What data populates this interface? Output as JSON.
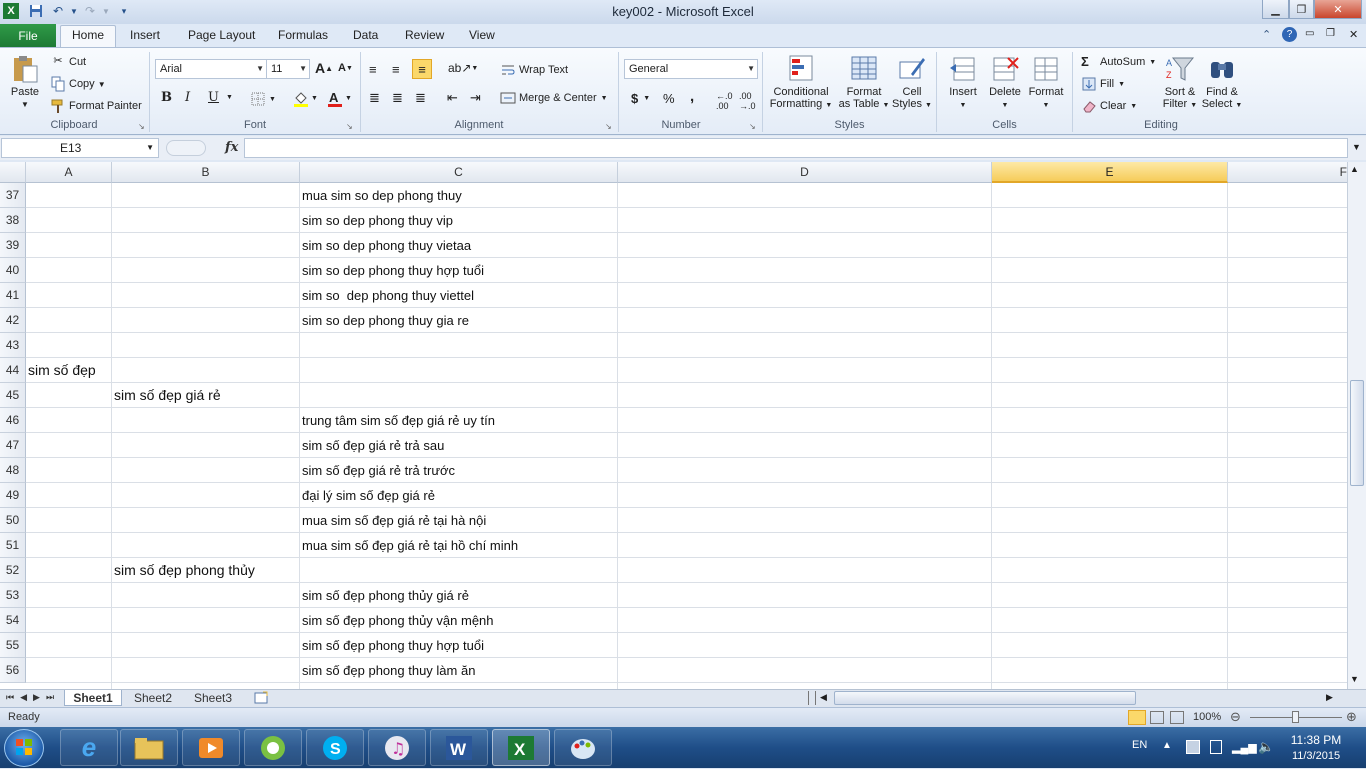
{
  "window": {
    "title": "key002  -  Microsoft Excel"
  },
  "ribbon_tabs": [
    "File",
    "Home",
    "Insert",
    "Page Layout",
    "Formulas",
    "Data",
    "Review",
    "View"
  ],
  "clipboard": {
    "paste": "Paste",
    "cut": "Cut",
    "copy": "Copy",
    "format_painter": "Format Painter",
    "label": "Clipboard"
  },
  "font": {
    "name": "Arial",
    "size": "11",
    "label": "Font",
    "bold": "B",
    "italic": "I",
    "underline": "U"
  },
  "alignment": {
    "wrap": "Wrap Text",
    "merge": "Merge & Center",
    "label": "Alignment"
  },
  "number": {
    "format": "General",
    "label": "Number",
    "currency": "$",
    "percent": "%",
    "comma": ","
  },
  "styles": {
    "conditional_l1": "Conditional",
    "conditional_l2": "Formatting",
    "table_l1": "Format",
    "table_l2": "as Table",
    "cell_l1": "Cell",
    "cell_l2": "Styles",
    "label": "Styles"
  },
  "cells": {
    "insert": "Insert",
    "delete": "Delete",
    "format": "Format",
    "label": "Cells"
  },
  "editing": {
    "autosum": "AutoSum",
    "fill": "Fill",
    "clear": "Clear",
    "sort_l1": "Sort &",
    "sort_l2": "Filter",
    "find_l1": "Find &",
    "find_l2": "Select",
    "label": "Editing"
  },
  "formula_bar": {
    "name_box": "E13",
    "fx": "fx",
    "value": ""
  },
  "columns": [
    "A",
    "B",
    "C",
    "D",
    "E",
    "F"
  ],
  "selected_column": "E",
  "rows": [
    {
      "n": "37",
      "a": "",
      "b": "",
      "c": "mua sim so dep phong thuy"
    },
    {
      "n": "38",
      "a": "",
      "b": "",
      "c": "sim so dep phong thuy vip"
    },
    {
      "n": "39",
      "a": "",
      "b": "",
      "c": "sim so dep phong thuy vietaa"
    },
    {
      "n": "40",
      "a": "",
      "b": "",
      "c": "sim so dep phong thuy hợp tuổi"
    },
    {
      "n": "41",
      "a": "",
      "b": "",
      "c": "sim so  dep phong thuy viettel"
    },
    {
      "n": "42",
      "a": "",
      "b": "",
      "c": "sim so dep phong thuy gia re"
    },
    {
      "n": "43",
      "a": "",
      "b": "",
      "c": ""
    },
    {
      "n": "44",
      "a": "sim số đẹp",
      "b": "",
      "c": ""
    },
    {
      "n": "45",
      "a": "",
      "b": "sim số đẹp giá rẻ",
      "c": ""
    },
    {
      "n": "46",
      "a": "",
      "b": "",
      "c": "trung tâm sim số đẹp giá rẻ uy tín"
    },
    {
      "n": "47",
      "a": "",
      "b": "",
      "c": "sim số đẹp giá rẻ trả sau"
    },
    {
      "n": "48",
      "a": "",
      "b": "",
      "c": "sim số đẹp giá rẻ trả trước"
    },
    {
      "n": "49",
      "a": "",
      "b": "",
      "c": "đại lý sim số đẹp giá rẻ"
    },
    {
      "n": "50",
      "a": "",
      "b": "",
      "c": "mua sim số đẹp giá rẻ tại hà nội"
    },
    {
      "n": "51",
      "a": "",
      "b": "",
      "c": "mua sim số đẹp giá rẻ tại hồ chí minh"
    },
    {
      "n": "52",
      "a": "",
      "b": "sim số đẹp phong thủy",
      "c": ""
    },
    {
      "n": "53",
      "a": "",
      "b": "",
      "c": "sim số đẹp phong thủy giá rẻ"
    },
    {
      "n": "54",
      "a": "",
      "b": "",
      "c": "sim số đẹp phong thủy vận mệnh"
    },
    {
      "n": "55",
      "a": "",
      "b": "",
      "c": "sim số đẹp phong thuy hợp tuổi"
    },
    {
      "n": "56",
      "a": "",
      "b": "",
      "c": "sim số đẹp phong thuy làm ăn"
    }
  ],
  "sheets": [
    "Sheet1",
    "Sheet2",
    "Sheet3"
  ],
  "active_sheet": "Sheet1",
  "status": {
    "ready": "Ready",
    "zoom": "100%"
  },
  "taskbar": {
    "lang": "EN",
    "time": "11:38 PM",
    "date": "11/3/2015"
  },
  "colors": {
    "file_tab": "#1d7a34",
    "selected_header": "#f6cc5a",
    "taskbar": "#1f4e88"
  }
}
